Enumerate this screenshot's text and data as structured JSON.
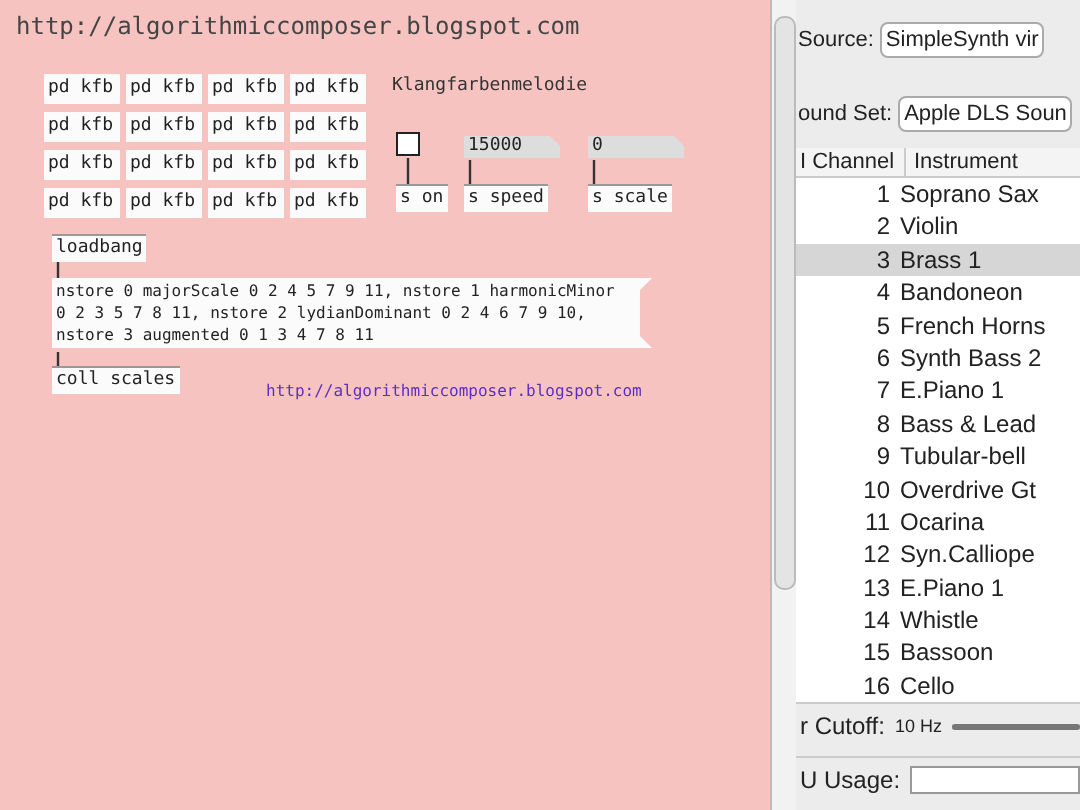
{
  "canvas": {
    "header": "http://algorithmiccomposer.blogspot.com",
    "subpatches": [
      "pd kfb",
      "pd kfb",
      "pd kfb",
      "pd kfb",
      "pd kfb",
      "pd kfb",
      "pd kfb",
      "pd kfb",
      "pd kfb",
      "pd kfb",
      "pd kfb",
      "pd kfb",
      "pd kfb",
      "pd kfb",
      "pd kfb",
      "pd kfb"
    ],
    "objects": [
      {
        "kind": "comment",
        "text": "Klangfarbenmelodie"
      },
      {
        "kind": "toggle",
        "checked": false
      },
      {
        "kind": "number",
        "text": "15000"
      },
      {
        "kind": "number",
        "text": "0"
      },
      {
        "kind": "object",
        "text": "s on"
      },
      {
        "kind": "object",
        "text": "s speed"
      },
      {
        "kind": "object",
        "text": "s scale"
      },
      {
        "kind": "object",
        "text": "loadbang"
      },
      {
        "kind": "message",
        "text": "nstore 0 majorScale 0 2 4 5 7 9 11, nstore 1 harmonicMinor 0 2 3 5 7 8 11, nstore 2 lydianDominant 0 2 4 6 7 9 10, nstore 3 augmented 0 1 3 4 7 8 11"
      },
      {
        "kind": "object",
        "text": "coll scales"
      },
      {
        "kind": "link",
        "text": "http://algorithmiccomposer.blogspot.com"
      }
    ]
  },
  "synth": {
    "source": {
      "label": "Source:",
      "value": "SimpleSynth vir"
    },
    "sound_set": {
      "label": "ound Set:",
      "value": "Apple DLS Soun"
    },
    "columns": [
      "I Channel",
      "Instrument"
    ],
    "rows": [
      {
        "channel": "1",
        "instrument": "Soprano Sax",
        "selected": false
      },
      {
        "channel": "2",
        "instrument": "Violin",
        "selected": false
      },
      {
        "channel": "3",
        "instrument": "Brass 1",
        "selected": true
      },
      {
        "channel": "4",
        "instrument": "Bandoneon",
        "selected": false
      },
      {
        "channel": "5",
        "instrument": "French Horns",
        "selected": false
      },
      {
        "channel": "6",
        "instrument": "Synth Bass 2",
        "selected": false
      },
      {
        "channel": "7",
        "instrument": "E.Piano 1",
        "selected": false
      },
      {
        "channel": "8",
        "instrument": "Bass & Lead",
        "selected": false
      },
      {
        "channel": "9",
        "instrument": "Tubular-bell",
        "selected": false
      },
      {
        "channel": "10",
        "instrument": "Overdrive Gt",
        "selected": false
      },
      {
        "channel": "11",
        "instrument": "Ocarina",
        "selected": false
      },
      {
        "channel": "12",
        "instrument": "Syn.Calliope",
        "selected": false
      },
      {
        "channel": "13",
        "instrument": "E.Piano 1",
        "selected": false
      },
      {
        "channel": "14",
        "instrument": "Whistle",
        "selected": false
      },
      {
        "channel": "15",
        "instrument": "Bassoon",
        "selected": false
      },
      {
        "channel": "16",
        "instrument": "Cello",
        "selected": false
      }
    ],
    "cutoff": {
      "label": "r Cutoff:",
      "value": "10 Hz",
      "level": 1
    },
    "cpu": {
      "label": "U Usage:"
    }
  }
}
